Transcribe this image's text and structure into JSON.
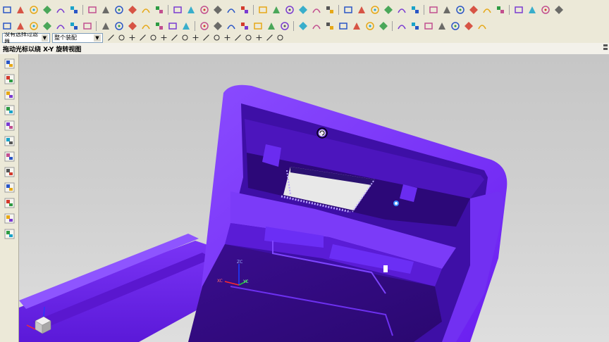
{
  "toolbar_row1_icons": [
    "line-icon",
    "arc-icon",
    "rectangle-icon",
    "point-icon",
    "text-icon",
    "house-icon",
    "fillet-icon",
    "spline-icon",
    "mirror-icon",
    "pattern-icon",
    "trim-icon",
    "zoom-icon",
    "curve-icon",
    "spline-tool-icon",
    "stamp-icon",
    "chamfer-icon",
    "grid-icon",
    "table-icon",
    "hatch-icon",
    "ruler-icon",
    "letter-m-icon",
    "angle-icon",
    "sweep-icon",
    "surface-icon",
    "shell-icon",
    "loft-icon",
    "offset-icon",
    "diamond-icon",
    "pencil-icon",
    "link-icon",
    "ribbon-icon",
    "palette-icon",
    "eraser-icon",
    "measure-icon",
    "gem-icon",
    "star-icon",
    "cube-icon",
    "gradient-icon",
    "dot-icon",
    "phone-icon"
  ],
  "toolbar_row2_icons": [
    "snap-icon",
    "datum-plane-icon",
    "datum-axis-icon",
    "block-icon",
    "cylinder-icon",
    "grid-tool-icon",
    "revolve-icon",
    "extrude-icon",
    "hole-icon",
    "boss-icon",
    "pocket-icon",
    "pad-icon",
    "cross-icon",
    "axis-icon",
    "f8-icon",
    "xform-icon",
    "move-icon",
    "align-icon",
    "bracket-icon",
    "square-icon",
    "frame-icon",
    "window-icon",
    "door-icon",
    "corner-icon",
    "column-icon",
    "hatch-grid-icon",
    "power-icon",
    "no-icon",
    "sparkle-icon",
    "dice-icon",
    "cube-orange-icon",
    "box-icon",
    "cube-outline-icon",
    "cube-gray-icon",
    "collapse-icon"
  ],
  "selection_filter": {
    "value": "没有选择过滤器"
  },
  "assembly_scope": {
    "value": "整个装配"
  },
  "status_bar": {
    "text": "拖动光标以绕 X-Y 旋转视图"
  },
  "resource_bar_icons": [
    "assembly-navigator-icon",
    "constraint-navigator-icon",
    "part-navigator-icon",
    "reuse-library-icon",
    "web-browser-icon",
    "history-icon",
    "clock-icon",
    "list-icon",
    "palette-icon",
    "role-icon",
    "people-icon",
    "roles-icon"
  ],
  "viewport": {
    "rotate_cursor_icon": "rotate-cursor-icon",
    "wcs_labels": {
      "xc": "XC",
      "yc": "YC",
      "zc": "ZC"
    },
    "colors": {
      "model": "#6a1ef0",
      "model_dark": "#3d0d9c",
      "model_light": "#8e55ff",
      "background_top": "#c6c6c6",
      "background_bottom": "#dedede"
    }
  }
}
